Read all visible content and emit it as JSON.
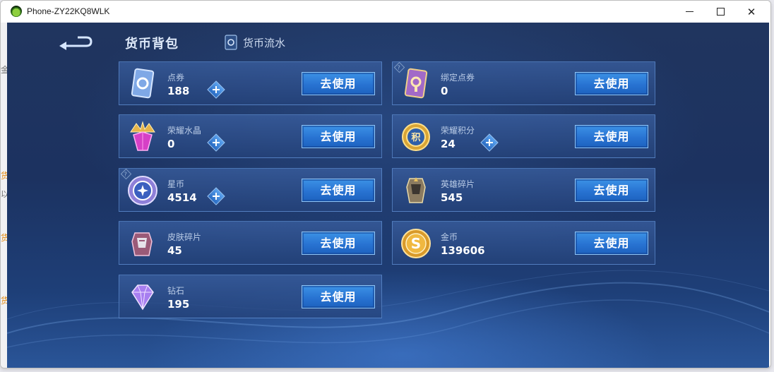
{
  "window": {
    "title": "Phone-ZY22KQ8WLK"
  },
  "underlay": {
    "chars": [
      "金",
      "货",
      "以",
      "货",
      "货"
    ]
  },
  "header": {
    "title": "货币背包",
    "flow_label": "货币流水"
  },
  "colors": {
    "accent": "#2a74d2",
    "panel_bg": "#1f3a6b",
    "text_light": "#b9cbe6"
  },
  "currencies": [
    {
      "name": "点券",
      "value": "188",
      "button": "去使用",
      "icon": "voucher-icon"
    },
    {
      "name": "绑定点券",
      "value": "0",
      "button": "去使用",
      "icon": "bound-voucher-icon"
    },
    {
      "name": "荣耀水晶",
      "value": "0",
      "button": "去使用",
      "icon": "glory-crystal-icon"
    },
    {
      "name": "荣耀积分",
      "value": "24",
      "button": "去使用",
      "icon": "glory-points-icon"
    },
    {
      "name": "星币",
      "value": "4514",
      "button": "去使用",
      "icon": "star-coin-icon"
    },
    {
      "name": "英雄碎片",
      "value": "545",
      "button": "去使用",
      "icon": "hero-fragment-icon"
    },
    {
      "name": "皮肤碎片",
      "value": "45",
      "button": "去使用",
      "icon": "skin-fragment-icon"
    },
    {
      "name": "金币",
      "value": "139606",
      "button": "去使用",
      "icon": "gold-coin-icon"
    },
    {
      "name": "钻石",
      "value": "195",
      "button": "去使用",
      "icon": "diamond-icon"
    }
  ]
}
